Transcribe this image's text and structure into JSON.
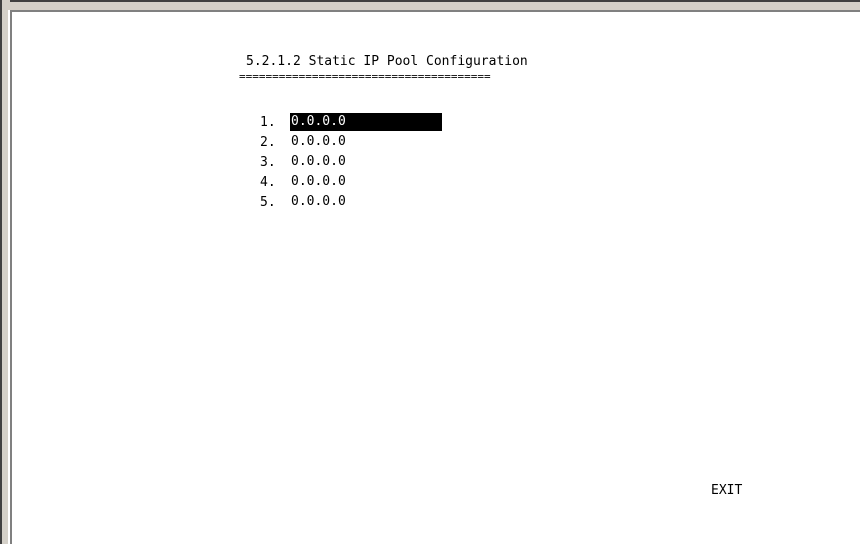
{
  "screen": {
    "title": "5.2.1.2 Static IP Pool Configuration",
    "title_underline": "======================================"
  },
  "ip_pool": {
    "entries": [
      {
        "number": "1.",
        "ip": "0.0.0.0",
        "selected": true
      },
      {
        "number": "2.",
        "ip": "0.0.0.0",
        "selected": false
      },
      {
        "number": "3.",
        "ip": "0.0.0.0",
        "selected": false
      },
      {
        "number": "4.",
        "ip": "0.0.0.0",
        "selected": false
      },
      {
        "number": "5.",
        "ip": "0.0.0.0",
        "selected": false
      }
    ]
  },
  "actions": {
    "exit_label": "EXIT"
  },
  "colors": {
    "background": "#ffffff",
    "text": "#000000",
    "highlight_bg": "#000000",
    "highlight_text": "#ffffff",
    "frame": "#d4d0c8"
  }
}
